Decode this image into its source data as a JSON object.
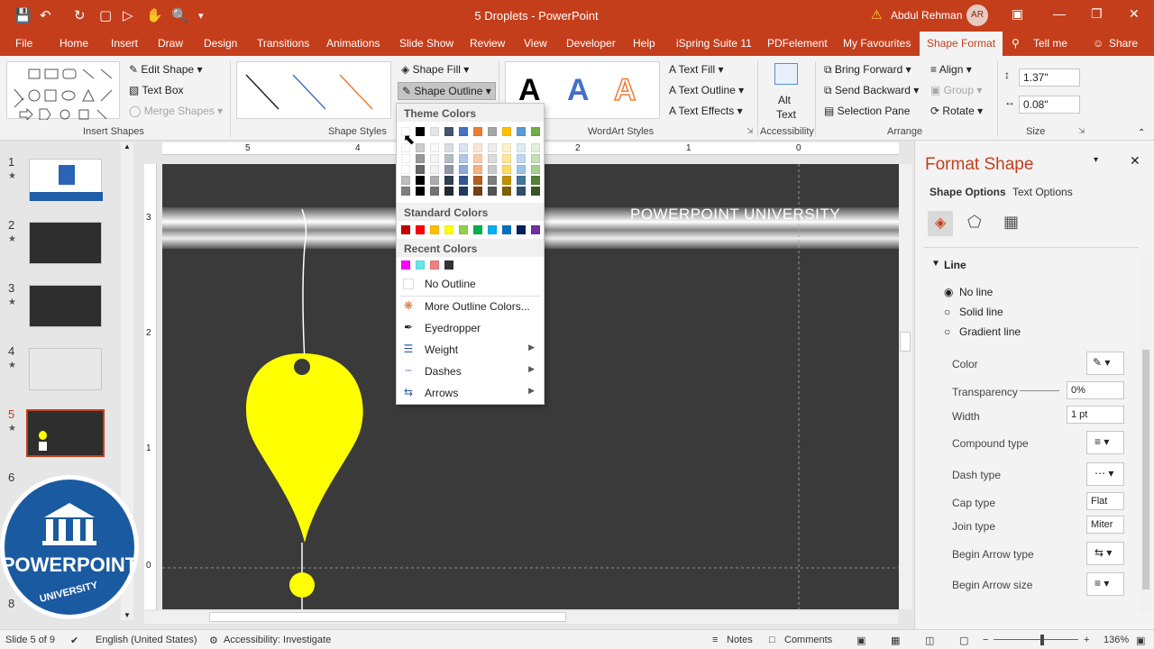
{
  "title_bar": {
    "document_title": "5 Droplets  -  PowerPoint",
    "user_name": "Abdul Rehman",
    "avatar_initials": "AR"
  },
  "tabs": [
    "File",
    "Home",
    "Insert",
    "Draw",
    "Design",
    "Transitions",
    "Animations",
    "Slide Show",
    "Review",
    "View",
    "Developer",
    "Help",
    "iSpring Suite 11",
    "PDFelement",
    "My Favourites",
    "Shape Format",
    "Tell me",
    "Share"
  ],
  "active_tab": "Shape Format",
  "ribbon": {
    "edit_shape": "Edit Shape",
    "text_box": "Text Box",
    "merge_shapes": "Merge Shapes",
    "insert_shapes_label": "Insert Shapes",
    "shape_fill": "Shape Fill",
    "shape_outline": "Shape Outline",
    "shape_styles_label": "Shape Styles",
    "wordart_label": "WordArt Styles",
    "text_fill": "Text Fill",
    "text_outline": "Text Outline",
    "text_effects": "Text Effects",
    "alt_text_1": "Alt",
    "alt_text_2": "Text",
    "accessibility_label": "Accessibility",
    "bring_forward": "Bring Forward",
    "send_backward": "Send Backward",
    "selection_pane": "Selection Pane",
    "align": "Align",
    "group": "Group",
    "rotate": "Rotate",
    "arrange_label": "Arrange",
    "height_value": "1.37\"",
    "width_value": "0.08\"",
    "size_label": "Size",
    "wordart_letter": "A"
  },
  "dropdown": {
    "theme_colors_header": "Theme Colors",
    "standard_colors_header": "Standard Colors",
    "recent_colors_header": "Recent Colors",
    "no_outline": "No Outline",
    "more_outline_colors": "More Outline Colors...",
    "eyedropper": "Eyedropper",
    "weight": "Weight",
    "dashes": "Dashes",
    "arrows": "Arrows",
    "theme_top_row": [
      "#ffffff",
      "#000000",
      "#e7e6e6",
      "#44546a",
      "#4472c4",
      "#ed7d31",
      "#a5a5a5",
      "#ffc000",
      "#5b9bd5",
      "#70ad47"
    ],
    "standard_colors": [
      "#c00000",
      "#ff0000",
      "#ffc000",
      "#ffff00",
      "#92d050",
      "#00b050",
      "#00b0f0",
      "#0070c0",
      "#002060",
      "#7030a0"
    ],
    "recent_colors": [
      "#ff00ff",
      "#66e6e6",
      "#f08080",
      "#333333"
    ]
  },
  "slide": {
    "banner_text": "POWERPOINT UNIVERSITY",
    "ruler_numbers": [
      "5",
      "4",
      "3",
      "2",
      "1",
      "0"
    ],
    "v_ruler_numbers": [
      "3",
      "2",
      "1",
      "0"
    ],
    "droplet_color": "#ffff00"
  },
  "slides_panel": {
    "numbers": [
      "1",
      "2",
      "3",
      "4",
      "5",
      "6",
      "8"
    ],
    "current": "5"
  },
  "format_pane": {
    "title": "Format Shape",
    "tab_shape_options": "Shape Options",
    "tab_text_options": "Text Options",
    "section_line": "Line",
    "no_line": "No line",
    "solid_line": "Solid line",
    "gradient_line": "Gradient line",
    "color": "Color",
    "transparency": "Transparency",
    "transparency_value": "0%",
    "width": "Width",
    "width_value": "1 pt",
    "compound_type": "Compound type",
    "dash_type": "Dash type",
    "cap_type": "Cap type",
    "cap_type_value": "Flat",
    "join_type": "Join type",
    "join_type_value": "Miter",
    "begin_arrow_type": "Begin Arrow type",
    "begin_arrow_size": "Begin Arrow size"
  },
  "status_bar": {
    "slide_info": "Slide 5 of 9",
    "language": "English (United States)",
    "accessibility": "Accessibility: Investigate",
    "notes": "Notes",
    "comments": "Comments",
    "zoom": "136%"
  },
  "logo": {
    "line1": "POWERPOINT",
    "line2": "UNIVERSITY"
  },
  "colors": {
    "accent": "#c43e1c",
    "slide_bg": "#3a3a3a"
  }
}
